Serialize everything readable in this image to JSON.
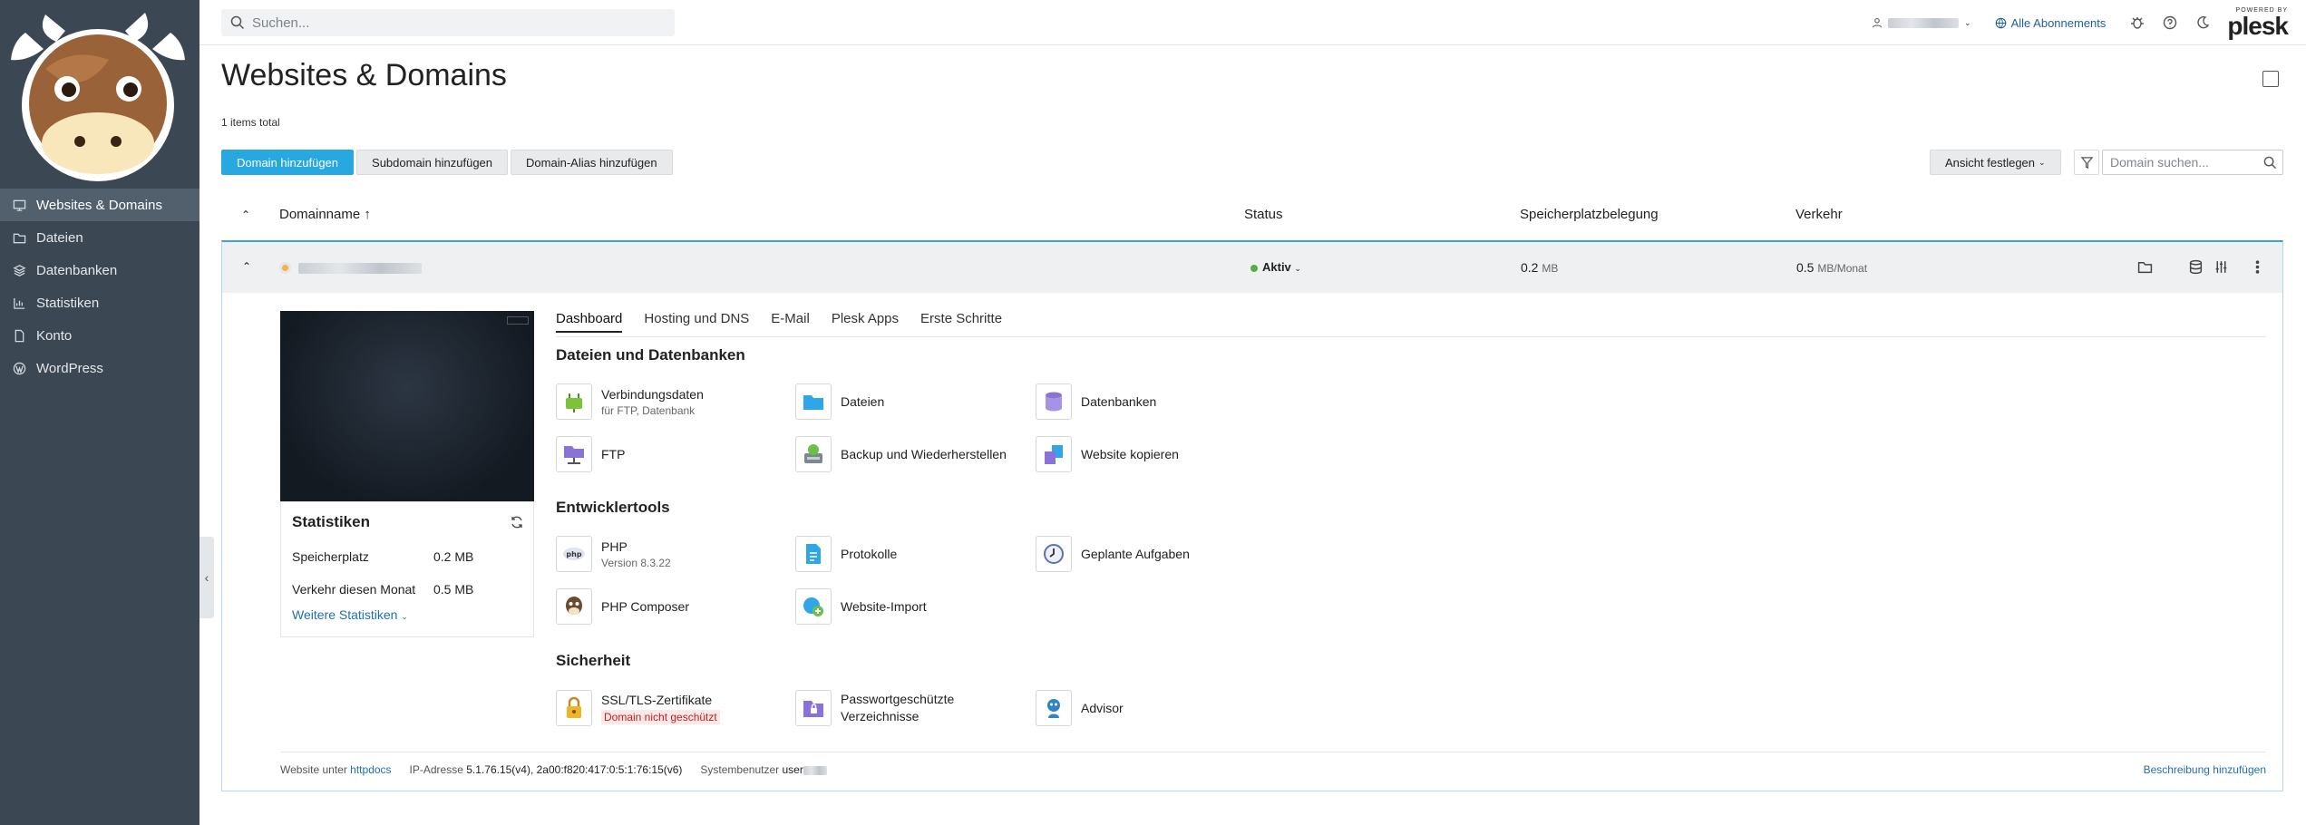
{
  "sidebar": {
    "items": [
      {
        "label": "Websites & Domains",
        "icon": "monitor-icon",
        "active": true
      },
      {
        "label": "Dateien",
        "icon": "folder-icon"
      },
      {
        "label": "Datenbanken",
        "icon": "database-icon"
      },
      {
        "label": "Statistiken",
        "icon": "chart-icon"
      },
      {
        "label": "Konto",
        "icon": "file-icon"
      },
      {
        "label": "WordPress",
        "icon": "wordpress-icon"
      }
    ]
  },
  "topbar": {
    "search_placeholder": "Suchen...",
    "subscriptions": "Alle Abonnements",
    "powered_by": "POWERED BY",
    "brand": "plesk"
  },
  "page": {
    "title": "Websites & Domains",
    "count": "1 items total"
  },
  "toolbar": {
    "add_domain": "Domain hinzufügen",
    "add_subdomain": "Subdomain hinzufügen",
    "add_alias": "Domain-Alias hinzufügen",
    "view": "Ansicht festlegen",
    "domain_search_placeholder": "Domain suchen..."
  },
  "table": {
    "columns": {
      "name": "Domainname ↑",
      "status": "Status",
      "disk": "Speicherplatzbelegung",
      "traffic": "Verkehr"
    },
    "row": {
      "status": "Aktiv",
      "disk_value": "0.2",
      "disk_unit": "MB",
      "traffic_value": "0.5",
      "traffic_unit": "MB/Monat"
    }
  },
  "stats": {
    "title": "Statistiken",
    "disk_label": "Speicherplatz",
    "disk_value": "0.2 MB",
    "traffic_label": "Verkehr diesen Monat",
    "traffic_value": "0.5 MB",
    "more": "Weitere Statistiken"
  },
  "tabs": [
    "Dashboard",
    "Hosting und DNS",
    "E-Mail",
    "Plesk Apps",
    "Erste Schritte"
  ],
  "sections": {
    "files": "Dateien und Datenbanken",
    "dev": "Entwicklertools",
    "security": "Sicherheit"
  },
  "tiles": {
    "connection": {
      "label": "Verbindungsdaten",
      "sub": "für FTP, Datenbank"
    },
    "files": {
      "label": "Dateien"
    },
    "databases": {
      "label": "Datenbanken"
    },
    "ftp": {
      "label": "FTP"
    },
    "backup": {
      "label": "Backup und Wiederherstellen"
    },
    "copy": {
      "label": "Website kopieren"
    },
    "php": {
      "label": "PHP",
      "sub": "Version 8.3.22"
    },
    "logs": {
      "label": "Protokolle"
    },
    "scheduled": {
      "label": "Geplante Aufgaben"
    },
    "composer": {
      "label": "PHP Composer"
    },
    "import": {
      "label": "Website-Import"
    },
    "ssl": {
      "label": "SSL/TLS-Zertifikate",
      "warn": "Domain nicht geschützt"
    },
    "protected": {
      "label": "Passwortgeschützte Verzeichnisse"
    },
    "advisor": {
      "label": "Advisor"
    }
  },
  "footer": {
    "website_label": "Website unter",
    "website_link": "httpdocs",
    "ip_label": "IP-Adresse",
    "ip_value": "5.1.76.15(v4), 2a00:f820:417:0:5:1:76:15(v6)",
    "user_label": "Systembenutzer",
    "user_value": "user",
    "add_description": "Beschreibung hinzufügen"
  },
  "colors": {
    "sidebar": "#3b4753",
    "primary": "#28a8e0",
    "active": "#52b045",
    "link": "#1f6fb2"
  }
}
